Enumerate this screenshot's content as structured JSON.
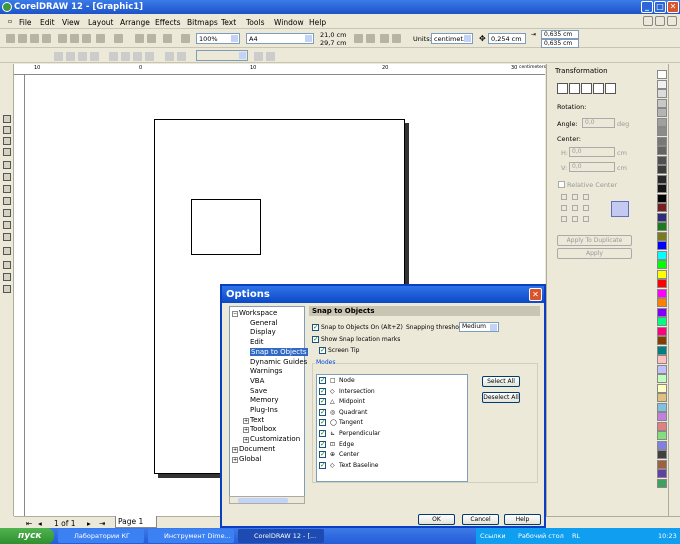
{
  "window": {
    "title": "CorelDRAW 12 - [Graphic1]"
  },
  "menu": [
    "File",
    "Edit",
    "View",
    "Layout",
    "Arrange",
    "Effects",
    "Bitmaps",
    "Text",
    "Tools",
    "Window",
    "Help"
  ],
  "toolbar": {
    "zoom": "100%",
    "paper": "A4",
    "width": "21,0 cm",
    "height": "29,7 cm",
    "units_label": "Units:",
    "units": "centimet...",
    "nudge": "0,254 cm",
    "dup_x": "0,635 cm",
    "dup_y": "0,635 cm"
  },
  "ruler": {
    "ticks": [
      "10",
      "0",
      "10",
      "20",
      "30"
    ],
    "unit": "centimeters"
  },
  "docker": {
    "title": "Transformation",
    "rotation_label": "Rotation:",
    "angle_label": "Angle:",
    "angle_value": "0,0",
    "angle_unit": "deg",
    "center_label": "Center:",
    "h_label": "H:",
    "h_value": "0,0",
    "v_label": "V:",
    "v_value": "0,0",
    "unit_cm": "cm",
    "relative_center": "Relative Center",
    "apply_duplicate": "Apply To Duplicate",
    "apply": "Apply"
  },
  "palette": [
    "#ffffff",
    "#f0f0f0",
    "#dcdcdc",
    "#c8c8c8",
    "#b4b4b4",
    "#a0a0a0",
    "#8c8c8c",
    "#787878",
    "#646464",
    "#505050",
    "#3c3c3c",
    "#282828",
    "#141414",
    "#000000",
    "#7a1f1f",
    "#2d2d7a",
    "#1f7a1f",
    "#7a7a1f",
    "#0000ff",
    "#00ffff",
    "#00ff00",
    "#ffff00",
    "#ff0000",
    "#ff00ff",
    "#ff8000",
    "#8000ff",
    "#00ff80",
    "#ff0080",
    "#804000",
    "#008080",
    "#ffc0c0",
    "#c0c0ff",
    "#c0ffc0",
    "#ffffc0",
    "#e0c080",
    "#80c0e0",
    "#c080e0",
    "#e08080",
    "#80e080",
    "#8080e0",
    "#404040",
    "#a06040",
    "#6040a0",
    "#40a060"
  ],
  "status": {
    "page_count": "1 of 1",
    "page_tab": "Page 1"
  },
  "taskbar": {
    "start": "пуск",
    "tasks": [
      "Лаборатории КГ",
      "Инструмент Dime...",
      "CorelDRAW 12 - [..."
    ],
    "tray_links": "Ссылки",
    "tray_desktop": "Рабочий стол",
    "tray_lang": "RL",
    "time": "10:23"
  },
  "dialog": {
    "title": "Options",
    "tree": [
      {
        "label": "Workspace",
        "level": 0,
        "expander": "−"
      },
      {
        "label": "General",
        "level": 1
      },
      {
        "label": "Display",
        "level": 1
      },
      {
        "label": "Edit",
        "level": 1
      },
      {
        "label": "Snap to Objects",
        "level": 1,
        "selected": true
      },
      {
        "label": "Dynamic Guides",
        "level": 1
      },
      {
        "label": "Warnings",
        "level": 1
      },
      {
        "label": "VBA",
        "level": 1
      },
      {
        "label": "Save",
        "level": 1
      },
      {
        "label": "Memory",
        "level": 1
      },
      {
        "label": "Plug-Ins",
        "level": 1
      },
      {
        "label": "Text",
        "level": 1,
        "expander": "+"
      },
      {
        "label": "Toolbox",
        "level": 1,
        "expander": "+"
      },
      {
        "label": "Customization",
        "level": 1,
        "expander": "+"
      },
      {
        "label": "Document",
        "level": 0,
        "expander": "+"
      },
      {
        "label": "Global",
        "level": 0,
        "expander": "+"
      }
    ],
    "section_title": "Snap to Objects",
    "snap_on": "Snap to Objects On (Alt+Z)",
    "threshold_label": "Snapping threshold",
    "threshold_value": "Medium",
    "show_marks": "Show Snap location marks",
    "screen_tip": "Screen Tip",
    "modes_label": "Modes",
    "modes": [
      {
        "icon": "□",
        "label": "Node"
      },
      {
        "icon": "◇",
        "label": "Intersection"
      },
      {
        "icon": "△",
        "label": "Midpoint"
      },
      {
        "icon": "◎",
        "label": "Quadrant"
      },
      {
        "icon": "◯",
        "label": "Tangent"
      },
      {
        "icon": "⊾",
        "label": "Perpendicular"
      },
      {
        "icon": "⊡",
        "label": "Edge"
      },
      {
        "icon": "⊕",
        "label": "Center"
      },
      {
        "icon": "◇",
        "label": "Text Baseline"
      }
    ],
    "select_all": "Select All",
    "deselect_all": "Deselect All",
    "ok": "OK",
    "cancel": "Cancel",
    "help": "Help"
  }
}
